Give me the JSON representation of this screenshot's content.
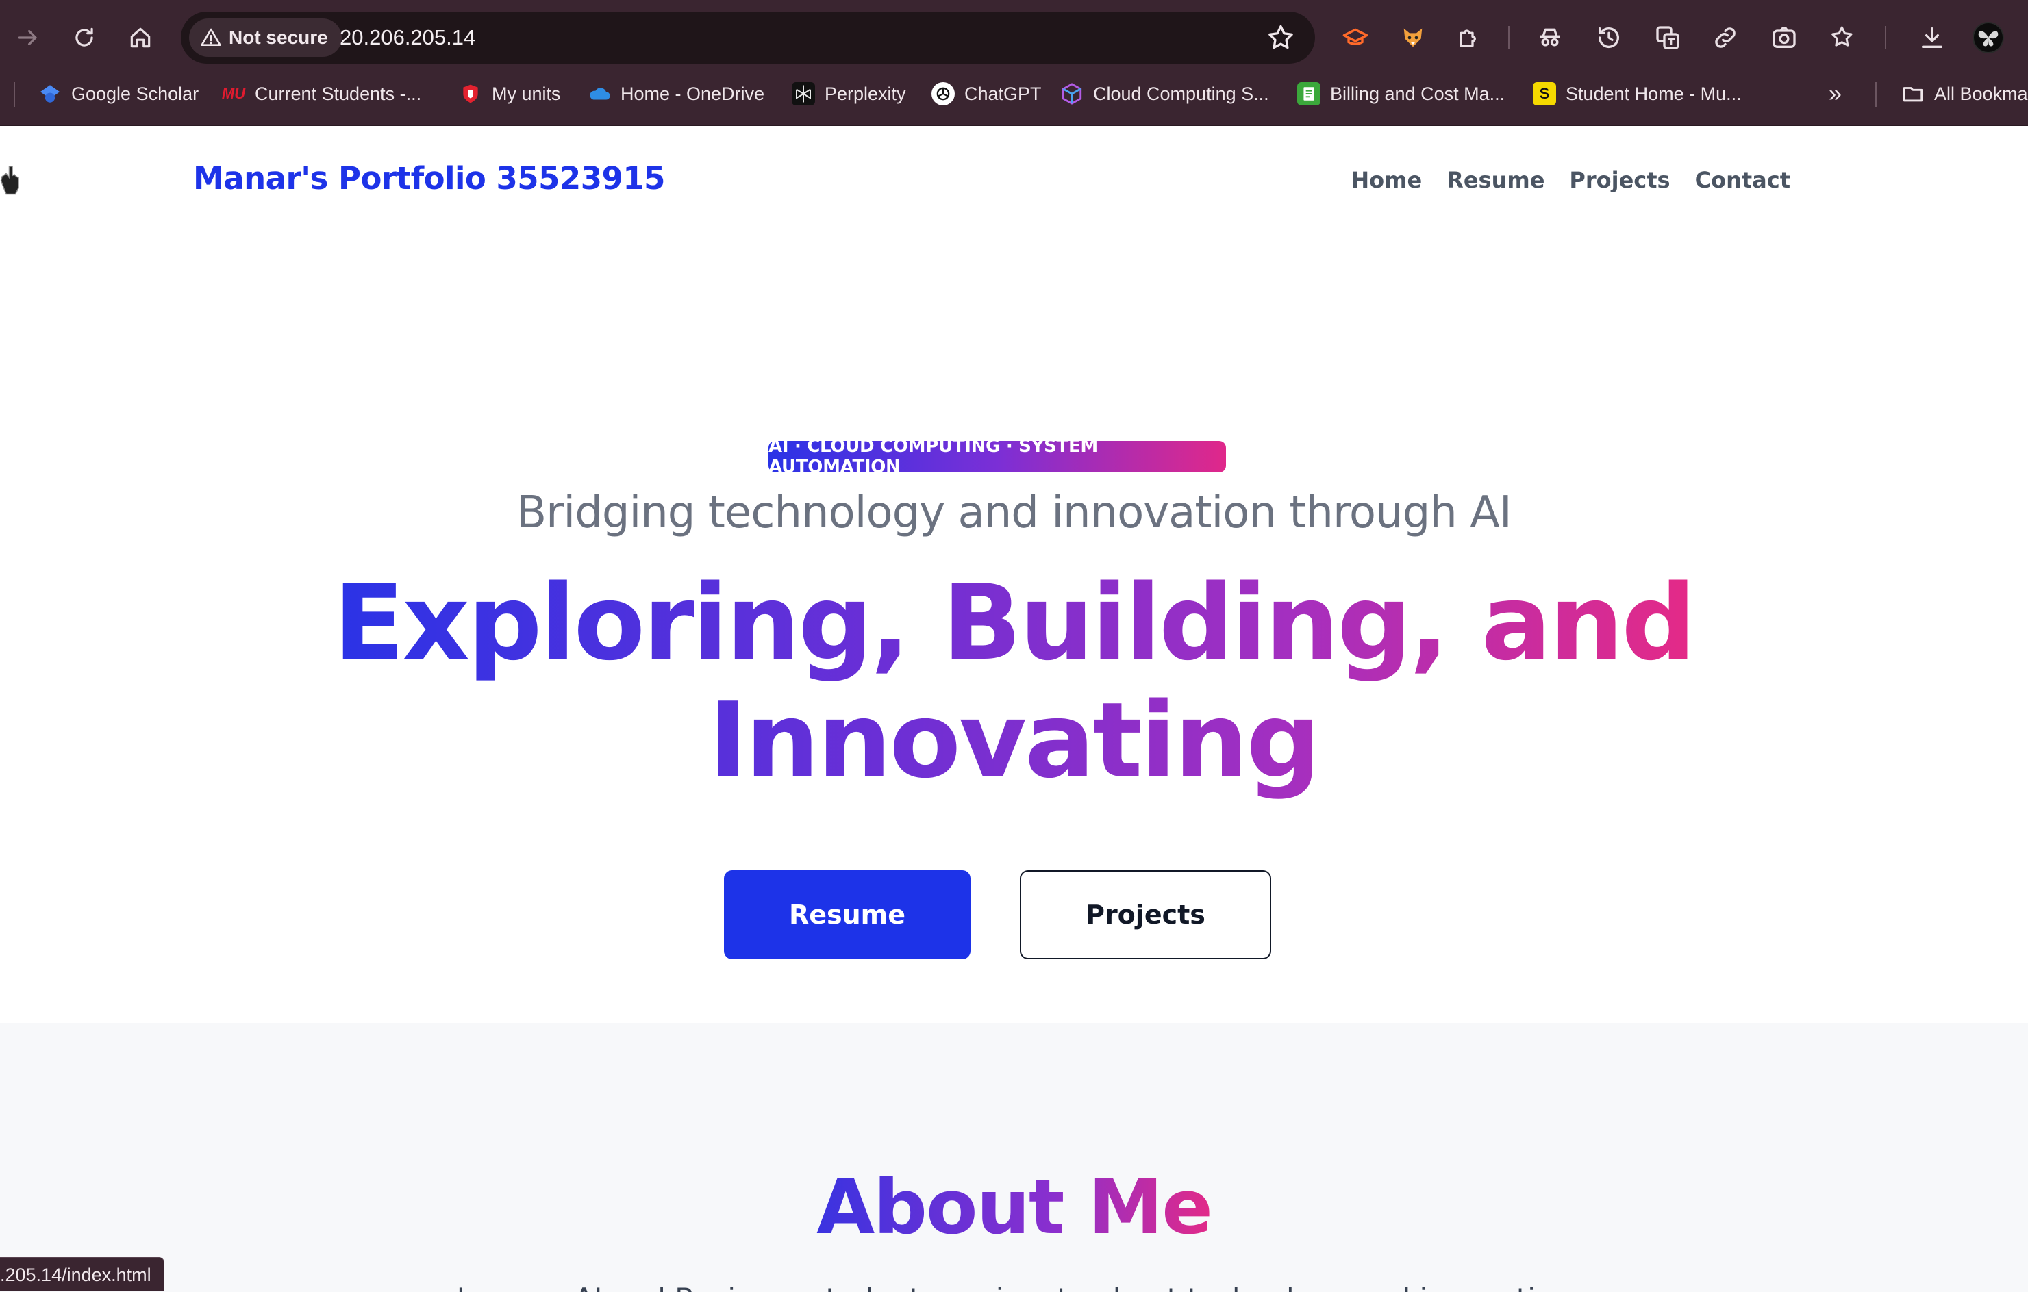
{
  "browser": {
    "security_label": "Not secure",
    "url": "20.206.205.14",
    "status_url": ".205.14/index.html",
    "bookmarks": [
      {
        "label": "Google Scholar",
        "icon": "google-scholar-icon"
      },
      {
        "label": "Current Students -...",
        "icon": "mu-icon"
      },
      {
        "label": "My units",
        "icon": "shield-icon"
      },
      {
        "label": "Home - OneDrive",
        "icon": "onedrive-icon"
      },
      {
        "label": "Perplexity",
        "icon": "perplexity-icon"
      },
      {
        "label": "ChatGPT",
        "icon": "chatgpt-icon"
      },
      {
        "label": "Cloud Computing S...",
        "icon": "cube-icon"
      },
      {
        "label": "Billing and Cost Ma...",
        "icon": "billing-icon"
      },
      {
        "label": "Student Home - Mu...",
        "icon": "s-icon"
      }
    ],
    "more_bookmarks": "»",
    "all_bookmarks": "All Bookma",
    "mu_badge": "MU",
    "s_badge": "S"
  },
  "site": {
    "brand": "Manar's Portfolio 35523915",
    "nav": [
      "Home",
      "Resume",
      "Projects",
      "Contact"
    ]
  },
  "hero": {
    "tag": "AI · CLOUD COMPUTING · SYSTEM AUTOMATION",
    "subtitle": "Bridging technology and innovation through AI",
    "headline_line1": "Exploring, Building, and",
    "headline_line2": "Innovating",
    "primary_button": "Resume",
    "secondary_button": "Projects"
  },
  "about": {
    "title": "About Me",
    "text": "I am an AI and Business student passionate about technology and innovation"
  },
  "colors": {
    "accent": "#1d33e8",
    "gradient_start": "#2a33e6",
    "gradient_end": "#e52a86",
    "chrome_bg": "#3a2530"
  }
}
